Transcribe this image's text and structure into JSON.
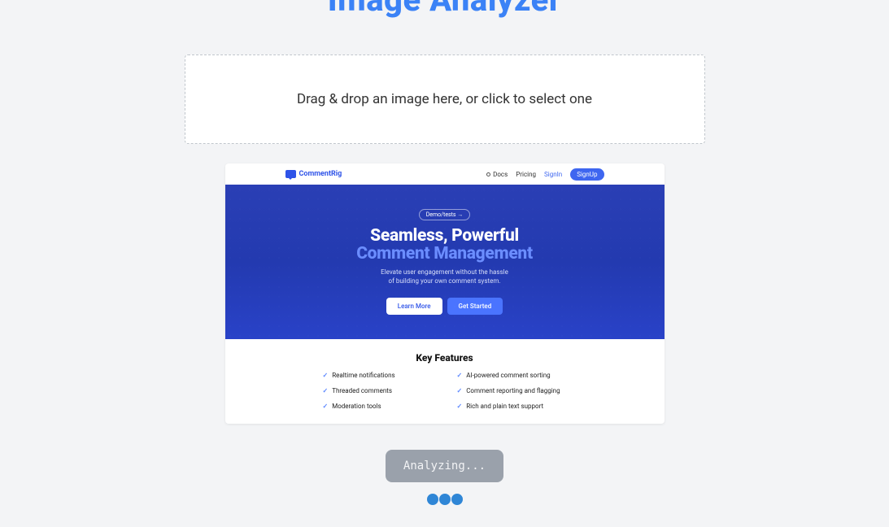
{
  "page": {
    "title": "Image Analyzer"
  },
  "dropzone": {
    "instructions": "Drag & drop an image here, or click to select one"
  },
  "preview": {
    "brand": "CommentRig",
    "nav": {
      "docs": "Docs",
      "pricing": "Pricing",
      "signin": "SignIn",
      "signup": "SignUp"
    },
    "hero": {
      "pill": "Demo/tests →",
      "headline_l1": "Seamless, Powerful",
      "headline_l2": "Comment Management",
      "sub_l1": "Elevate user engagement without the hassle",
      "sub_l2": "of building your own comment system.",
      "cta_primary": "Learn More",
      "cta_secondary": "Get Started"
    },
    "features": {
      "heading": "Key Features",
      "items": [
        "Realtime notifications",
        "AI-powered comment sorting",
        "Threaded comments",
        "Comment reporting and flagging",
        "Moderation tools",
        "Rich and plain text support"
      ]
    }
  },
  "actions": {
    "analyze_label": "Analyzing..."
  },
  "colors": {
    "accent": "#3b82f6",
    "hero_bg": "#2437a8"
  }
}
